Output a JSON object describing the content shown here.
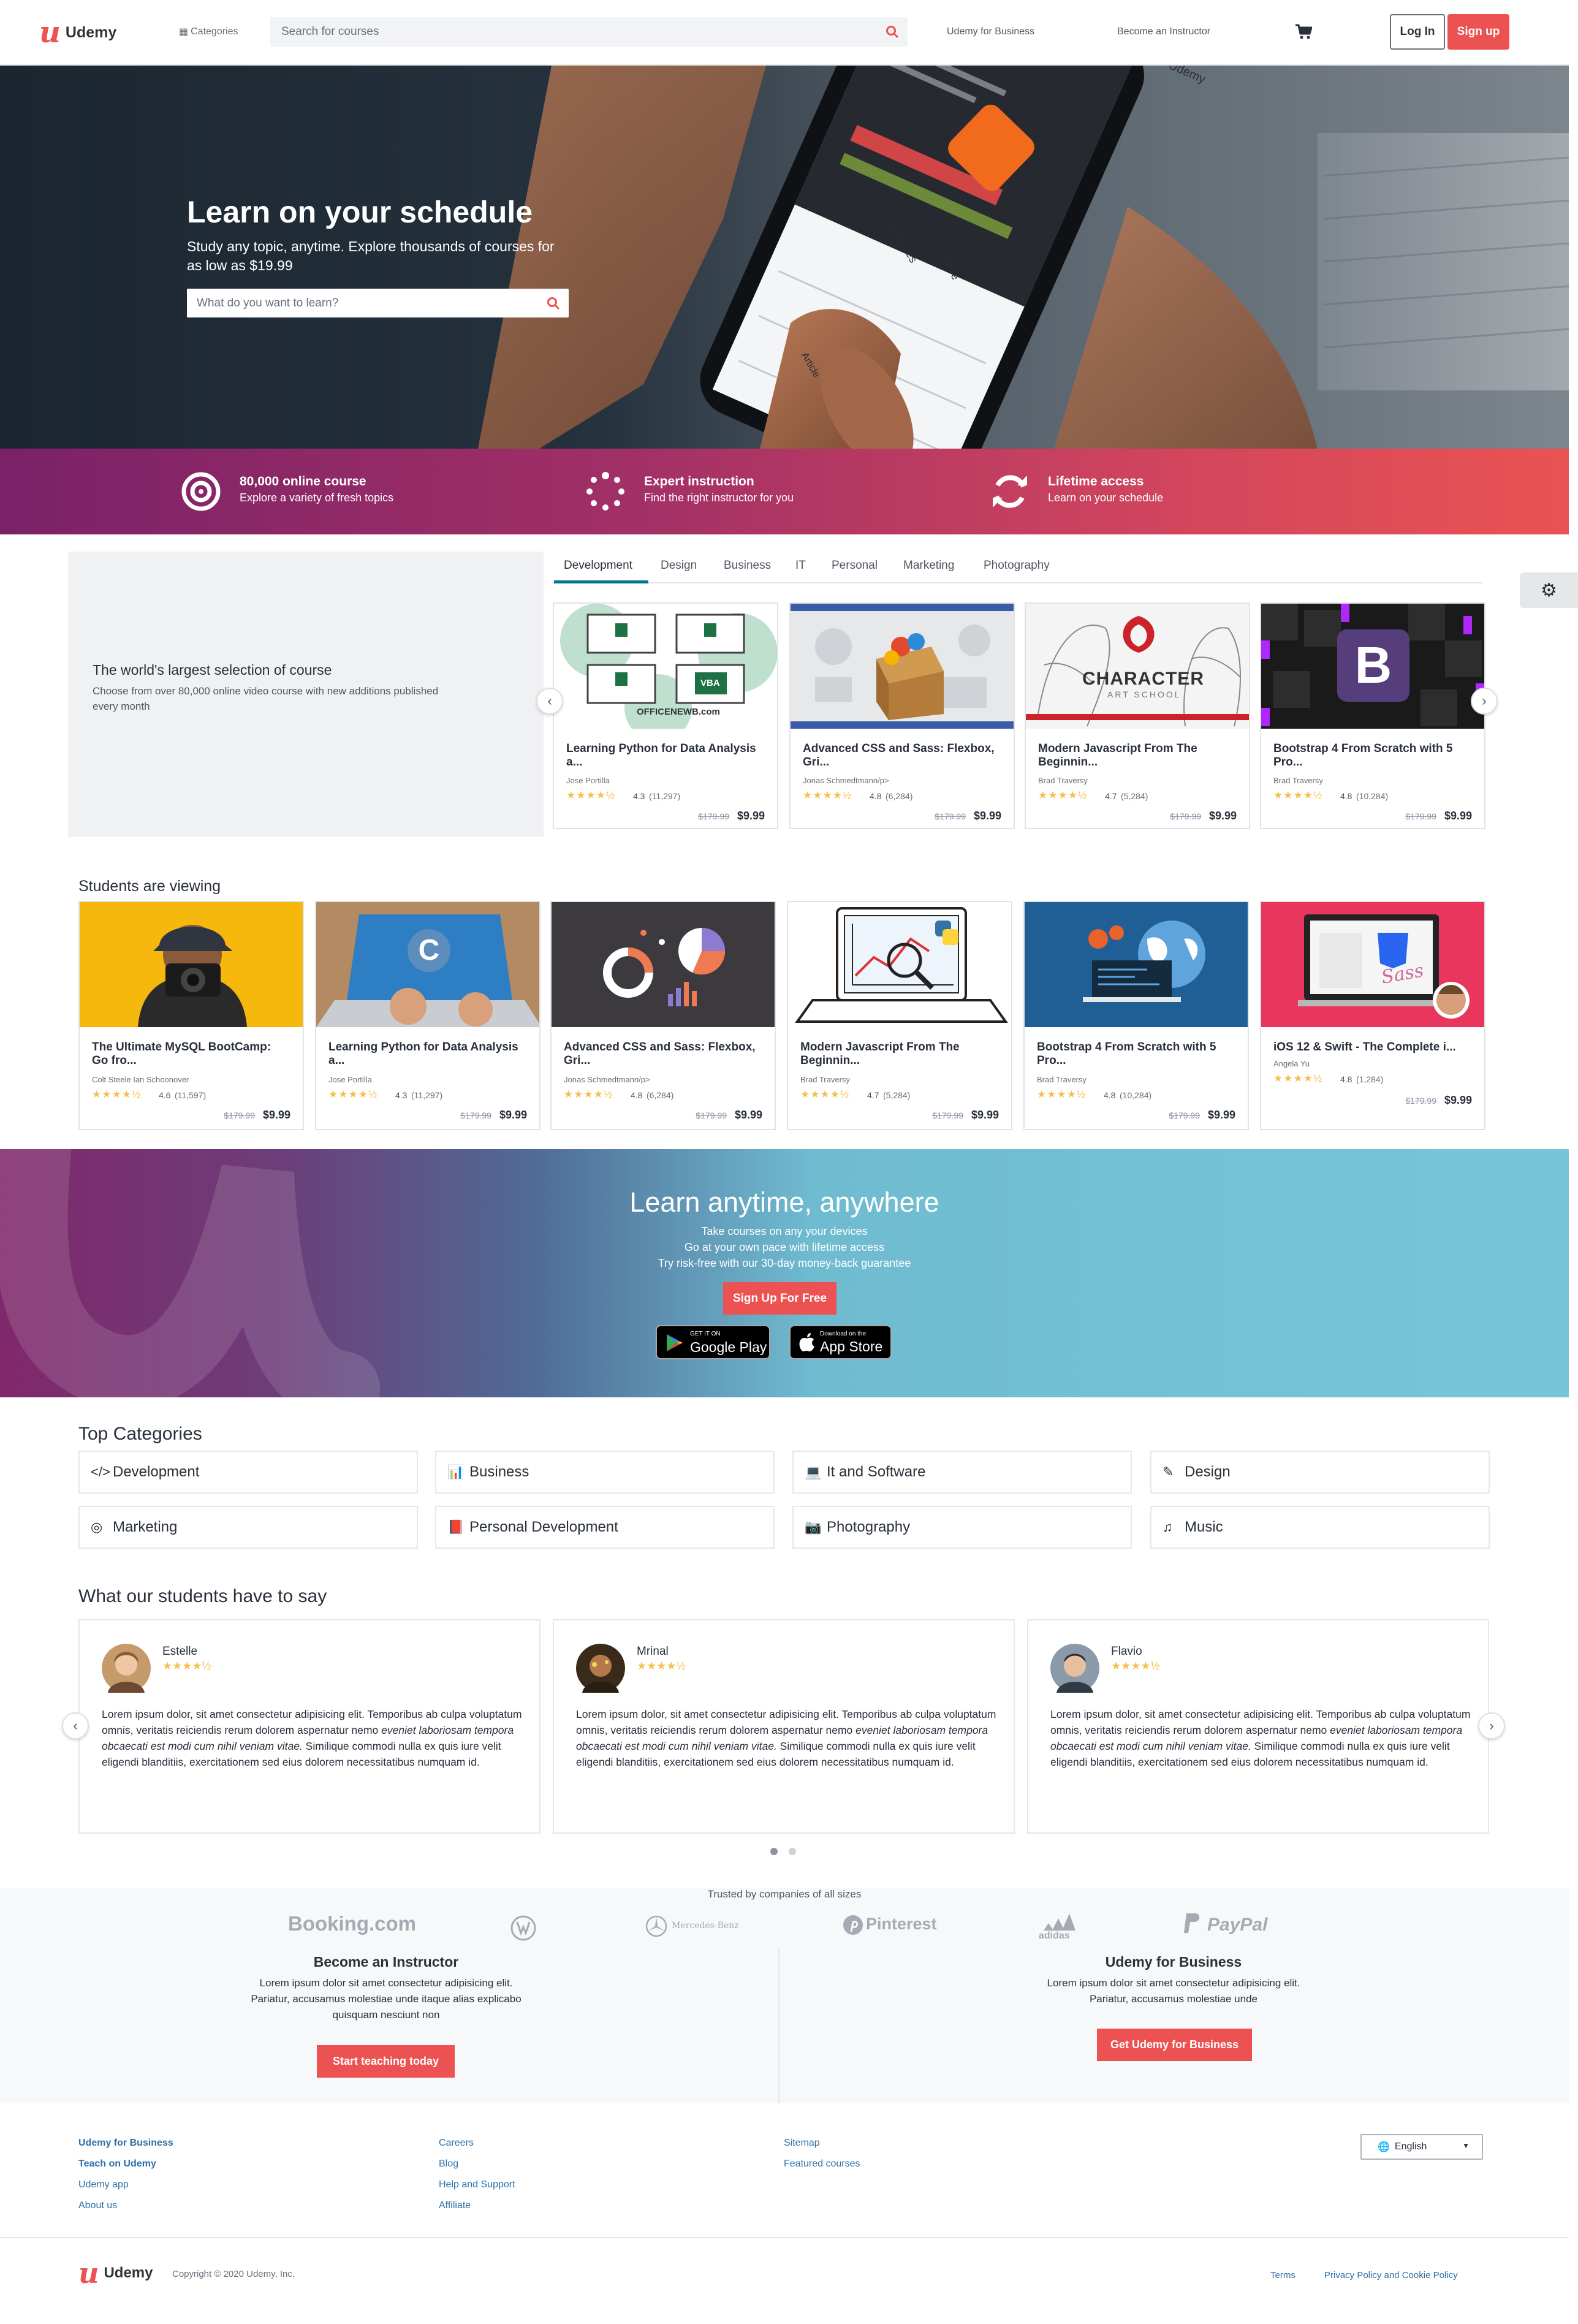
{
  "header": {
    "logo": "Udemy",
    "categories": "Categories",
    "search_placeholder": "Search for courses",
    "business": "Udemy for Business",
    "instructor": "Become an Instructor",
    "login": "Log In",
    "signup": "Sign up"
  },
  "hero": {
    "title": "Learn on your schedule",
    "subtitle_line1": "Study any topic, anytime. Explore thousands of courses for",
    "subtitle_line2": "as low as $19.99",
    "search_placeholder": "What do you want to learn?",
    "phone_words": [
      "Udemy",
      "Lectures",
      "More",
      "Article"
    ]
  },
  "features": [
    {
      "title": "80,000 online course",
      "desc": "Explore a variety of fresh topics",
      "icon": "target-icon"
    },
    {
      "title": "Expert instruction",
      "desc": "Find the right instructor for you",
      "icon": "spinner-icon"
    },
    {
      "title": "Lifetime access",
      "desc": "Learn on your schedule",
      "icon": "refresh-icon"
    }
  ],
  "selection": {
    "title": "The world's largest selection of course",
    "desc_line1": "Choose from over 80,000 online video course with new additions published",
    "desc_line2": "every month",
    "tabs": [
      "Development",
      "Design",
      "Business",
      "IT",
      "Personal",
      "Marketing",
      "Photography"
    ],
    "active_tab": "Development",
    "courses": [
      {
        "title1": "Learning Python for Data Analysis",
        "title2": "a...",
        "author": "Jose Portilla",
        "rating": "4.3",
        "count": "(11,297)",
        "old": "$179.99",
        "price": "$9.99",
        "thumb_text": "OFFICENEWB.com",
        "thumb_labels": [
          "VBA"
        ]
      },
      {
        "title1": "Advanced CSS and Sass: Flexbox,",
        "title2": "Gri...",
        "author": "Jonas Schmedtmann/p>",
        "rating": "4.8",
        "count": "(6,284)",
        "old": "$179.99",
        "price": "$9.99"
      },
      {
        "title1": "Modern Javascript From The",
        "title2": "Beginnin...",
        "author": "Brad Traversy",
        "rating": "4.7",
        "count": "(5,284)",
        "old": "$179.99",
        "price": "$9.99",
        "thumb_text": "CHARACTER",
        "thumb_sub": "ART SCHOOL"
      },
      {
        "title1": "Bootstrap 4 From Scratch with 5",
        "title2": "Pro...",
        "author": "Brad Traversy",
        "rating": "4.8",
        "count": "(10,284)",
        "old": "$179.99",
        "price": "$9.99",
        "thumb_text": "B"
      }
    ]
  },
  "viewing": {
    "title": "Students are viewing",
    "courses": [
      {
        "title1": "The Ultimate MySQL BootCamp:",
        "title2": "Go fro...",
        "author": "Colt Steele Ian Schoonover",
        "rating": "4.6",
        "count": "(11,597)",
        "old": "$179.99",
        "price": "$9.99"
      },
      {
        "title1": "Learning Python for Data Analysis",
        "title2": "a...",
        "author": "Jose Portilla",
        "rating": "4.3",
        "count": "(11,297)",
        "old": "$179.99",
        "price": "$9.99",
        "thumb_text": "C"
      },
      {
        "title1": "Advanced CSS and Sass: Flexbox,",
        "title2": "Gri...",
        "author": "Jonas Schmedtmann/p>",
        "rating": "4.8",
        "count": "(6,284)",
        "old": "$179.99",
        "price": "$9.99"
      },
      {
        "title1": "Modern Javascript From The",
        "title2": "Beginnin...",
        "author": "Brad Traversy",
        "rating": "4.7",
        "count": "(5,284)",
        "old": "$179.99",
        "price": "$9.99"
      },
      {
        "title1": "Bootstrap 4 From Scratch with 5",
        "title2": "Pro...",
        "author": "Brad Traversy",
        "rating": "4.8",
        "count": "(10,284)",
        "old": "$179.99",
        "price": "$9.99"
      },
      {
        "title1": "iOS 12 & Swift - The Complete i...",
        "title2": "",
        "author": "Angela Yu",
        "rating": "4.8",
        "count": "(1,284)",
        "old": "$179.99",
        "price": "$9.99",
        "thumb_text": "Sass"
      }
    ]
  },
  "promo": {
    "title": "Learn anytime, anywhere",
    "line1": "Take courses on any your devices",
    "line2": "Go at your own pace with lifetime access",
    "line3": "Try risk-free with our 30-day money-back guarantee",
    "cta": "Sign Up For Free",
    "google_small": "GET IT ON",
    "google": "Google Play",
    "apple_small": "Download on the",
    "apple": "App Store"
  },
  "categories": {
    "title": "Top Categories",
    "items": [
      {
        "label": "Development",
        "icon": "code-icon"
      },
      {
        "label": "Business",
        "icon": "chart-icon"
      },
      {
        "label": "It and Software",
        "icon": "laptop-icon"
      },
      {
        "label": "Design",
        "icon": "pencil-icon"
      },
      {
        "label": "Marketing",
        "icon": "target-icon"
      },
      {
        "label": "Personal Development",
        "icon": "book-icon"
      },
      {
        "label": "Photography",
        "icon": "camera-icon"
      },
      {
        "label": "Music",
        "icon": "music-icon"
      }
    ]
  },
  "testimonials": {
    "title": "What our students have to say",
    "items": [
      {
        "name": "Estelle"
      },
      {
        "name": "Mrinal"
      },
      {
        "name": "Flavio"
      }
    ],
    "text_a": "Lorem ipsum dolor, sit amet consectetur adipisicing elit. Temporibus ab culpa voluptatum omnis, veritatis reiciendis rerum dolorem aspernatur nemo ",
    "text_em": "eveniet laboriosam tempora obcaecati est modi cum nihil veniam vitae.",
    "text_b": " Similique commodi nulla ex quis iure velit eligendi blanditiis, exercitationem sed eius dolorem necessitatibus numquam id."
  },
  "trusted": {
    "title": "Trusted by companies of all sizes",
    "logos": [
      "Booking.com",
      "VW",
      "Mercedes-Benz",
      "Pinterest",
      "adidas",
      "PayPal"
    ]
  },
  "instructor": {
    "title": "Become an Instructor",
    "line1": "Lorem ipsum dolor sit amet consectetur adipisicing elit.",
    "line2": "Pariatur, accusamus molestiae unde itaque alias explicabo",
    "line3": "quisquam nesciunt non",
    "cta": "Start teaching today"
  },
  "business": {
    "title": "Udemy for Business",
    "line1": "Lorem ipsum dolor sit amet consectetur adipisicing elit.",
    "line2": "Pariatur, accusamus molestiae unde",
    "cta": "Get Udemy for Business"
  },
  "footer": {
    "col1": [
      "Udemy for Business",
      "Teach on Udemy",
      "Udemy app",
      "About us"
    ],
    "col2": [
      "Careers",
      "Blog",
      "Help and Support",
      "Affiliate"
    ],
    "col3": [
      "Sitemap",
      "Featured courses"
    ],
    "language": "English",
    "logo": "Udemy",
    "copyright": "Copyright © 2020 Udemy, Inc.",
    "terms": "Terms",
    "privacy": "Privacy Policy and Cookie Policy"
  },
  "colors": {
    "brand": "#ec5252",
    "link": "#2b6fa8",
    "star": "#f4c150",
    "strip_start": "#7b2168",
    "strip_end": "#ea5353"
  }
}
